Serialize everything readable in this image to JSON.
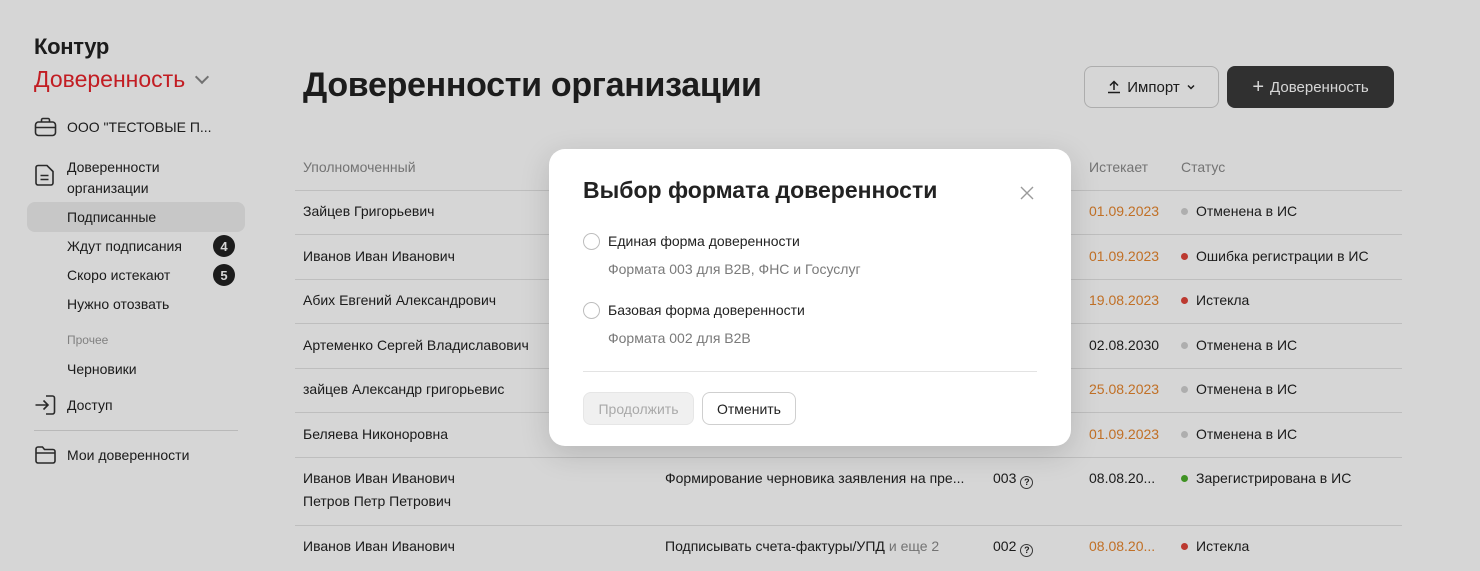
{
  "brand": {
    "company": "Контур",
    "product": "Доверенность"
  },
  "sidebar": {
    "org": "ООО \"ТЕСТОВЫЕ П...",
    "docs": "Доверенности организации",
    "items": [
      {
        "label": "Подписанные",
        "badge": ""
      },
      {
        "label": "Ждут подписания",
        "badge": "4"
      },
      {
        "label": "Скоро истекают",
        "badge": "5"
      },
      {
        "label": "Нужно отозвать",
        "badge": ""
      }
    ],
    "other_label": "Прочее",
    "drafts": "Черновики",
    "access": "Доступ",
    "my": "Мои доверенности"
  },
  "header": {
    "title": "Доверенности организации",
    "import_label": "Импорт",
    "new_label": "Доверенность"
  },
  "table": {
    "headers": {
      "authorized": "Уполномоченный",
      "expires": "Истекает",
      "status": "Статус"
    },
    "rows": [
      {
        "authorized": "Зайцев Григорьевич",
        "authorized2": "",
        "powers": "",
        "powers_more": "",
        "format": "",
        "expires": "01.09.2023",
        "expires_orange": true,
        "status": "Отменена в ИС",
        "status_color": "#d0d0d0"
      },
      {
        "authorized": "Иванов Иван Иванович",
        "authorized2": "",
        "powers": "",
        "powers_more": "",
        "format": "",
        "expires": "01.09.2023",
        "expires_orange": true,
        "status": "Ошибка регистрации в ИС",
        "status_color": "#e0453a"
      },
      {
        "authorized": "Абих Евгений Александрович",
        "authorized2": "",
        "powers": "",
        "powers_more": "",
        "format": "",
        "expires": "19.08.2023",
        "expires_orange": true,
        "status": "Истекла",
        "status_color": "#e0453a"
      },
      {
        "authorized": "Артеменко Сергей Владиславович",
        "authorized2": "",
        "powers": "",
        "powers_more": "",
        "format": "",
        "expires": "02.08.2030",
        "expires_orange": false,
        "status": "Отменена в ИС",
        "status_color": "#d0d0d0"
      },
      {
        "authorized": "зайцев Александр григорьевис",
        "authorized2": "",
        "powers": "",
        "powers_more": "",
        "format": "",
        "expires": "25.08.2023",
        "expires_orange": true,
        "status": "Отменена в ИС",
        "status_color": "#d0d0d0"
      },
      {
        "authorized": "Беляева Никоноровна",
        "authorized2": "",
        "powers": "",
        "powers_more": "",
        "format": "",
        "expires": "01.09.2023",
        "expires_orange": true,
        "status": "Отменена в ИС",
        "status_color": "#d0d0d0"
      },
      {
        "authorized": "Иванов Иван Иванович",
        "authorized2": "Петров Петр Петрович",
        "powers": "Формирование черновика заявления на пре...",
        "powers_more": "",
        "format": "003",
        "expires": "08.08.20...",
        "expires_orange": false,
        "status": "Зарегистрирована в ИС",
        "status_color": "#4caf2a"
      },
      {
        "authorized": "Иванов Иван Иванович",
        "authorized2": "",
        "powers": "Подписывать счета-фактуры/УПД",
        "powers_more": "и еще 2",
        "format": "002",
        "expires": "08.08.20...",
        "expires_orange": true,
        "status": "Истекла",
        "status_color": "#e0453a"
      }
    ]
  },
  "modal": {
    "title": "Выбор формата доверенности",
    "options": [
      {
        "title": "Единая форма доверенности",
        "desc": "Формата 003 для B2B, ФНС и Госуслуг"
      },
      {
        "title": "Базовая форма доверенности",
        "desc": "Формата 002 для B2B"
      }
    ],
    "continue_label": "Продолжить",
    "cancel_label": "Отменить"
  },
  "colors": {
    "brand_red": "#e8232a",
    "expires_orange": "#e6862e"
  },
  "icons": {
    "org": "briefcase-icon",
    "docs": "document-icon",
    "access": "login-icon",
    "my": "folder-icon",
    "import": "upload-icon",
    "new": "plus-icon",
    "close": "close-icon"
  }
}
